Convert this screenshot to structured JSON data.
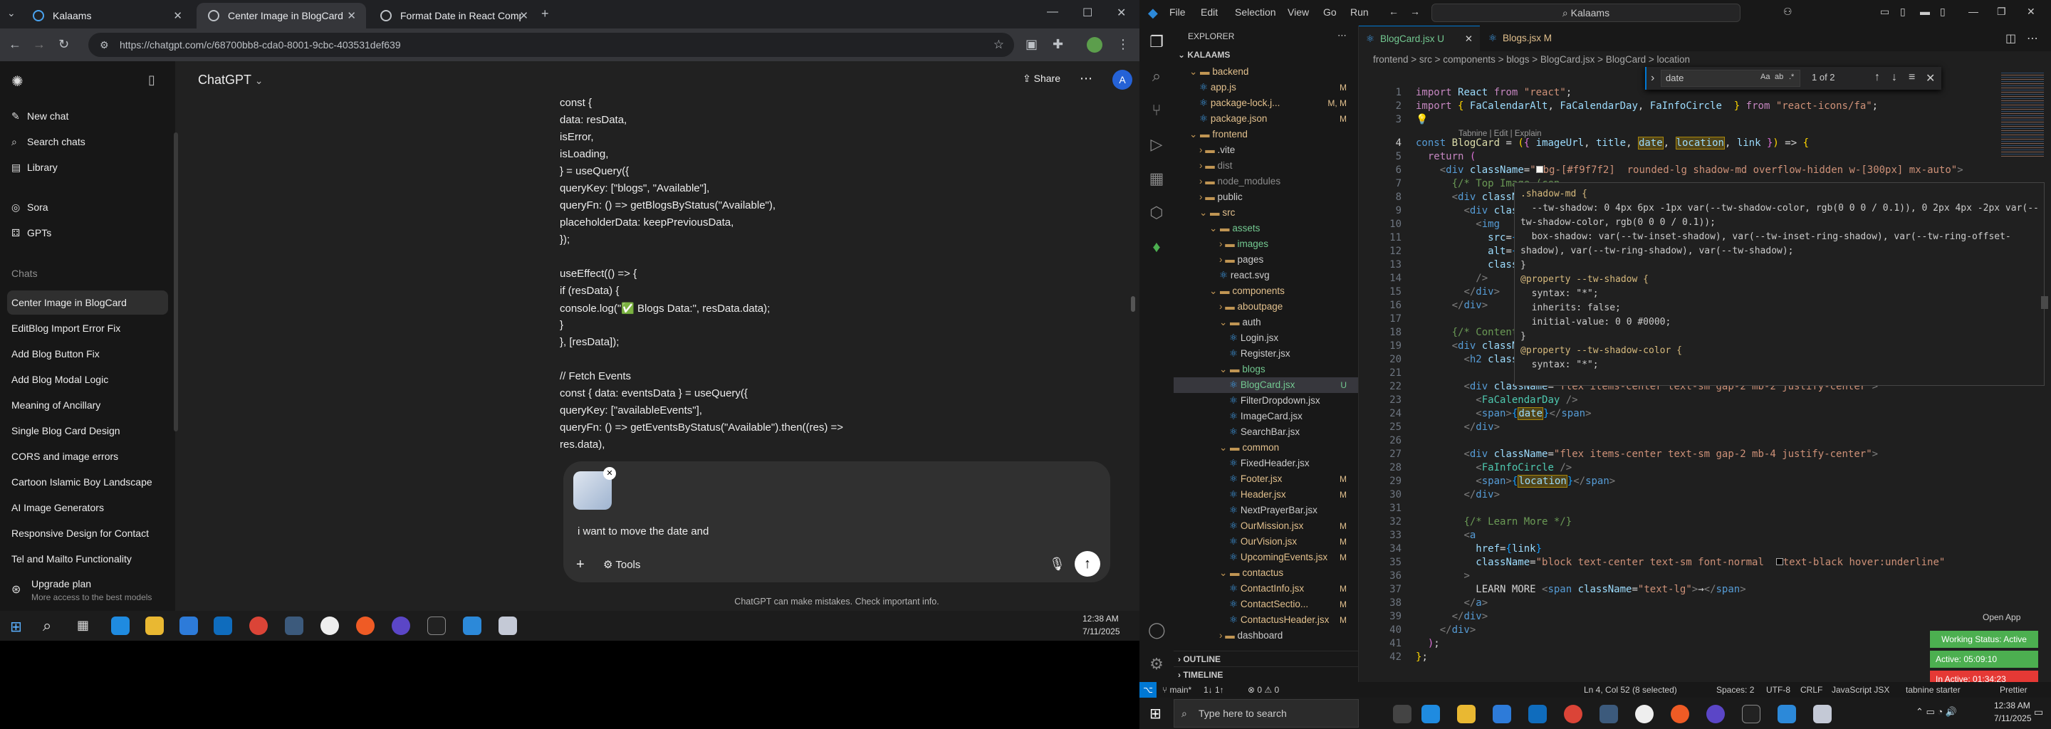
{
  "left_browser": {
    "tabs": [
      {
        "label": "Kalaams"
      },
      {
        "label": "Center Image in BlogCard"
      },
      {
        "label": "Format Date in React Compon"
      }
    ],
    "url": "https://chatgpt.com/c/68700bb8-cda0-8001-9cbc-403531def639",
    "chatgpt": {
      "header_title": "ChatGPT",
      "share_label": "Share",
      "avatar_letter": "A",
      "sidebar": {
        "new_chat": "New chat",
        "search": "Search chats",
        "library": "Library",
        "sora": "Sora",
        "gpts": "GPTs",
        "chats_heading": "Chats",
        "chats": [
          "Center Image in BlogCard",
          "EditBlog Import Error Fix",
          "Add Blog Button Fix",
          "Add Blog Modal Logic",
          "Meaning of Ancillary",
          "Single Blog Card Design",
          "CORS and image errors",
          "Cartoon Islamic Boy Landscape",
          "AI Image Generators",
          "Responsive Design for Contact",
          "Tel and Mailto Functionality"
        ],
        "upgrade_title": "Upgrade plan",
        "upgrade_sub": "More access to the best models"
      },
      "code_lines": [
        "const {",
        "  data: resData,",
        "  isError,",
        "  isLoading,",
        "} = useQuery({",
        "  queryKey: [\"blogs\", \"Available\"],",
        "  queryFn: () => getBlogsByStatus(\"Available\"),",
        "  placeholderData: keepPreviousData,",
        "});",
        "",
        "useEffect(() => {",
        "if (resData) {",
        "  console.log(\"✅ Blogs Data:\", resData.data);",
        "}",
        "}, [resData]);",
        "",
        "// Fetch Events",
        "const { data: eventsData } = useQuery({",
        "  queryKey: [\"availableEvents\"],",
        "  queryFn: () => getEventsByStatus(\"Available\").then((res) =>",
        "res.data),"
      ],
      "composer_text": "i want to move the date and",
      "tools_label": "Tools",
      "disclaimer": "ChatGPT can make mistakes. Check important info."
    },
    "taskbar_time": "12:38 AM",
    "taskbar_date": "7/11/2025"
  },
  "vscode": {
    "menu": [
      "File",
      "Edit",
      "Selection",
      "View",
      "Go",
      "Run"
    ],
    "search_label": "Kalaams",
    "explorer_title": "EXPLORER",
    "root": "KALAAMS",
    "tree": [
      {
        "label": "backend",
        "depth": 1,
        "type": "folder-open",
        "color": "#e2c08d",
        "status": ""
      },
      {
        "label": "app.js",
        "depth": 2,
        "type": "file",
        "color": "#e2c08d",
        "status": "M"
      },
      {
        "label": "package-lock.j...",
        "depth": 2,
        "type": "file",
        "color": "#e2c08d",
        "status": "M, M"
      },
      {
        "label": "package.json",
        "depth": 2,
        "type": "file",
        "color": "#e2c08d",
        "status": "M"
      },
      {
        "label": "frontend",
        "depth": 1,
        "type": "folder-open",
        "color": "#e2c08d",
        "status": ""
      },
      {
        "label": ".vite",
        "depth": 2,
        "type": "folder",
        "color": "#cccccc",
        "status": ""
      },
      {
        "label": "dist",
        "depth": 2,
        "type": "folder",
        "color": "#8b8b8b",
        "status": ""
      },
      {
        "label": "node_modules",
        "depth": 2,
        "type": "folder",
        "color": "#8b8b8b",
        "status": ""
      },
      {
        "label": "public",
        "depth": 2,
        "type": "folder",
        "color": "#cccccc",
        "status": ""
      },
      {
        "label": "src",
        "depth": 2,
        "type": "folder-open",
        "color": "#e2c08d",
        "status": ""
      },
      {
        "label": "assets",
        "depth": 3,
        "type": "folder-open",
        "color": "#73c991",
        "status": ""
      },
      {
        "label": "images",
        "depth": 4,
        "type": "folder",
        "color": "#73c991",
        "status": ""
      },
      {
        "label": "pages",
        "depth": 4,
        "type": "folder",
        "color": "#cccccc",
        "status": ""
      },
      {
        "label": "react.svg",
        "depth": 4,
        "type": "file",
        "color": "#cccccc",
        "status": ""
      },
      {
        "label": "components",
        "depth": 3,
        "type": "folder-open",
        "color": "#e2c08d",
        "status": ""
      },
      {
        "label": "aboutpage",
        "depth": 4,
        "type": "folder",
        "color": "#e2c08d",
        "status": ""
      },
      {
        "label": "auth",
        "depth": 4,
        "type": "folder-open",
        "color": "#cccccc",
        "status": ""
      },
      {
        "label": "Login.jsx",
        "depth": 5,
        "type": "file",
        "color": "#cccccc",
        "status": ""
      },
      {
        "label": "Register.jsx",
        "depth": 5,
        "type": "file",
        "color": "#cccccc",
        "status": ""
      },
      {
        "label": "blogs",
        "depth": 4,
        "type": "folder-open",
        "color": "#73c991",
        "status": ""
      },
      {
        "label": "BlogCard.jsx",
        "depth": 5,
        "type": "file",
        "color": "#73c991",
        "status": "U",
        "selected": true
      },
      {
        "label": "FilterDropdown.jsx",
        "depth": 5,
        "type": "file",
        "color": "#cccccc",
        "status": ""
      },
      {
        "label": "ImageCard.jsx",
        "depth": 5,
        "type": "file",
        "color": "#cccccc",
        "status": ""
      },
      {
        "label": "SearchBar.jsx",
        "depth": 5,
        "type": "file",
        "color": "#cccccc",
        "status": ""
      },
      {
        "label": "common",
        "depth": 4,
        "type": "folder-open",
        "color": "#e2c08d",
        "status": ""
      },
      {
        "label": "FixedHeader.jsx",
        "depth": 5,
        "type": "file",
        "color": "#cccccc",
        "status": ""
      },
      {
        "label": "Footer.jsx",
        "depth": 5,
        "type": "file",
        "color": "#e2c08d",
        "status": "M"
      },
      {
        "label": "Header.jsx",
        "depth": 5,
        "type": "file",
        "color": "#e2c08d",
        "status": "M"
      },
      {
        "label": "NextPrayerBar.jsx",
        "depth": 5,
        "type": "file",
        "color": "#cccccc",
        "status": ""
      },
      {
        "label": "OurMission.jsx",
        "depth": 5,
        "type": "file",
        "color": "#e2c08d",
        "status": "M"
      },
      {
        "label": "OurVision.jsx",
        "depth": 5,
        "type": "file",
        "color": "#e2c08d",
        "status": "M"
      },
      {
        "label": "UpcomingEvents.jsx",
        "depth": 5,
        "type": "file",
        "color": "#e2c08d",
        "status": "M"
      },
      {
        "label": "contactus",
        "depth": 4,
        "type": "folder-open",
        "color": "#e2c08d",
        "status": ""
      },
      {
        "label": "ContactInfo.jsx",
        "depth": 5,
        "type": "file",
        "color": "#e2c08d",
        "status": "M"
      },
      {
        "label": "ContactSectio...",
        "depth": 5,
        "type": "file",
        "color": "#e2c08d",
        "status": "M"
      },
      {
        "label": "ContactusHeader.jsx",
        "depth": 5,
        "type": "file",
        "color": "#e2c08d",
        "status": "M"
      },
      {
        "label": "dashboard",
        "depth": 4,
        "type": "folder",
        "color": "#cccccc",
        "status": ""
      }
    ],
    "outline_label": "OUTLINE",
    "timeline_label": "TIMELINE",
    "tabs": [
      {
        "label": "BlogCard.jsx",
        "suffix": "U",
        "active": true
      },
      {
        "label": "Blogs.jsx",
        "suffix": "M",
        "active": false
      }
    ],
    "breadcrumb": "frontend > src > components > blogs > BlogCard.jsx > BlogCard > location",
    "find_value": "date",
    "find_result": "1 of 2",
    "tabnine_hint": "Tabnine | Edit | Explain",
    "status": {
      "branch": "main*",
      "sync": "1↓ 1↑",
      "errors": "0 ⚠ 0",
      "position": "Ln 4, Col 52 (8 selected)",
      "spaces": "Spaces: 2",
      "encoding": "UTF-8",
      "eol": "CRLF",
      "language": "JavaScript JSX",
      "tabnine": "tabnine starter",
      "prettier": "Prettier"
    },
    "widgets": {
      "open_app": "Open App",
      "working_status": "Working Status: Active",
      "active_time": "Active: 05:09:10",
      "inactive_time": "In Active: 01:34:23"
    },
    "hover_lines": [
      ".shadow-md {",
      "  --tw-shadow: 0 4px 6px -1px var(--tw-shadow-color, rgb(0 0 0 / 0.1)), 0 2px 4px -2px var(--",
      "tw-shadow-color, rgb(0 0 0 / 0.1));",
      "  box-shadow: var(--tw-inset-shadow), var(--tw-inset-ring-shadow), var(--tw-ring-offset-",
      "shadow), var(--tw-ring-shadow), var(--tw-shadow);",
      "}",
      "@property --tw-shadow {",
      "  syntax: \"*\";",
      "  inherits: false;",
      "  initial-value: 0 0 #0000;",
      "}",
      "@property --tw-shadow-color {",
      "  syntax: \"*\";"
    ],
    "taskbar": {
      "search_placeholder": "Type here to search",
      "time": "12:38 AM",
      "date": "7/11/2025"
    }
  }
}
